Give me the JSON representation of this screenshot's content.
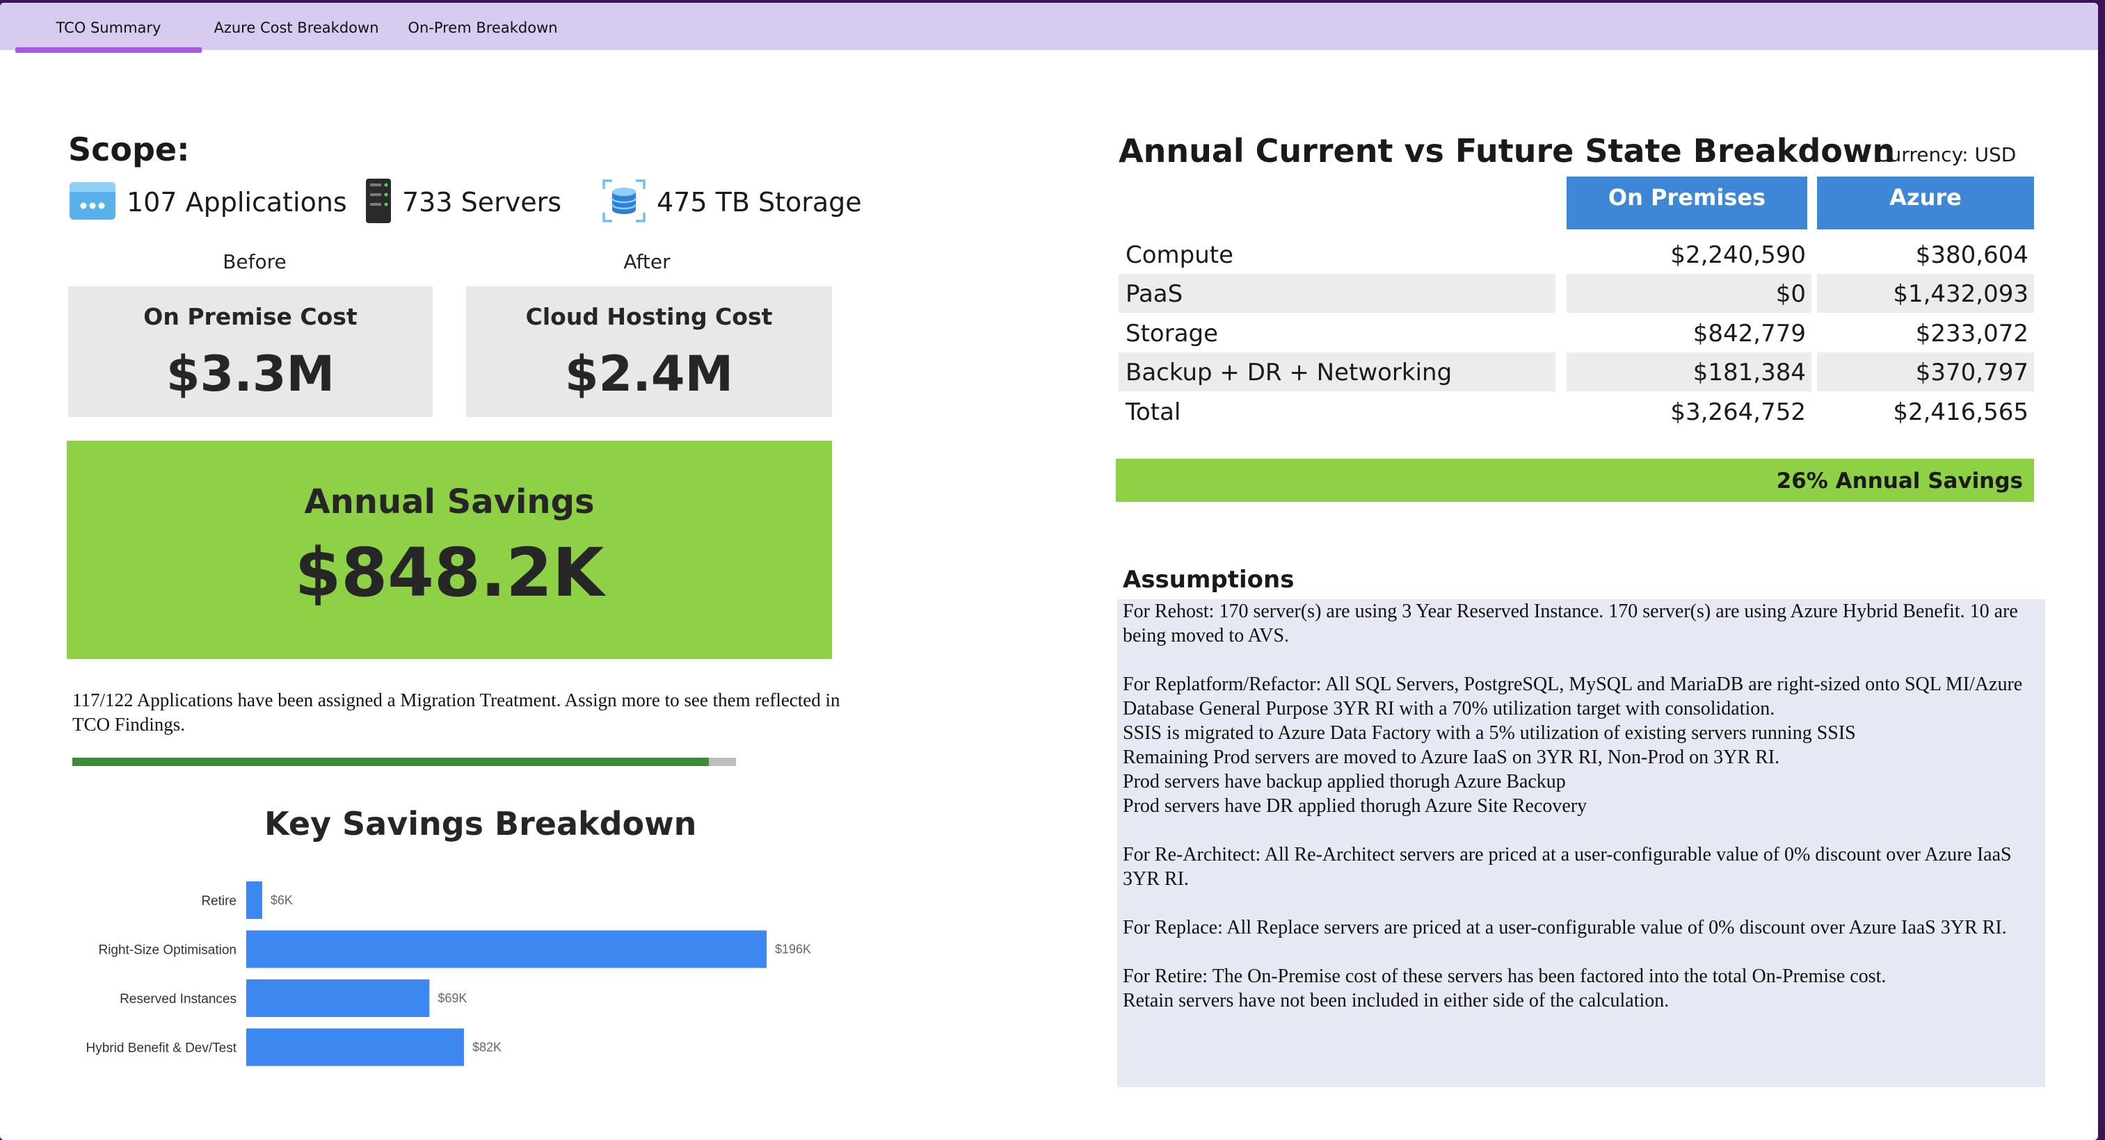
{
  "tabs": [
    {
      "label": "TCO Summary",
      "active": true
    },
    {
      "label": "Azure Cost Breakdown",
      "active": false
    },
    {
      "label": "On-Prem Breakdown",
      "active": false
    }
  ],
  "scope": {
    "title": "Scope:",
    "items": [
      {
        "icon": "application-window-icon",
        "label": "107 Applications"
      },
      {
        "icon": "server-icon",
        "label": "733 Servers"
      },
      {
        "icon": "storage-database-icon",
        "label": "475 TB Storage"
      }
    ]
  },
  "before_label": "Before",
  "after_label": "After",
  "on_premise_card": {
    "title": "On Premise Cost",
    "value": "$3.3M"
  },
  "cloud_card": {
    "title": "Cloud Hosting Cost",
    "value": "$2.4M"
  },
  "annual_savings": {
    "title": "Annual Savings",
    "value": "$848.2K"
  },
  "migration_progress": {
    "text": "117/122 Applications have been assigned a Migration Treatment. Assign more to see them reflected in TCO Findings.",
    "assigned": 117,
    "total": 122
  },
  "key_savings": {
    "title": "Key Savings Breakdown",
    "chart_data": {
      "type": "bar",
      "orientation": "horizontal",
      "categories": [
        "Retire",
        "Right-Size Optimisation",
        "Reserved Instances",
        "Hybrid Benefit & Dev/Test"
      ],
      "values": [
        6,
        196,
        69,
        82
      ],
      "value_labels": [
        "$6K",
        "$196K",
        "$69K",
        "$82K"
      ],
      "unit": "$K",
      "color": "#3d87f0",
      "title": "Key Savings Breakdown",
      "grid": false
    }
  },
  "breakdown": {
    "title": "Annual Current vs Future State Breakdown",
    "currency": "Currency: USD",
    "columns": [
      "On Premises",
      "Azure"
    ],
    "rows": [
      {
        "label": "Compute",
        "on_prem": "$2,240,590",
        "azure": "$380,604"
      },
      {
        "label": "PaaS",
        "on_prem": "$0",
        "azure": "$1,432,093"
      },
      {
        "label": "Storage",
        "on_prem": "$842,779",
        "azure": "$233,072"
      },
      {
        "label": "Backup + DR + Networking",
        "on_prem": "$181,384",
        "azure": "$370,797"
      },
      {
        "label": "Total",
        "on_prem": "$3,264,752",
        "azure": "$2,416,565"
      }
    ],
    "savings_label": "26% Annual Savings"
  },
  "assumptions": {
    "title": "Assumptions",
    "paragraphs": [
      [
        "For Rehost: 170 server(s) are using 3 Year Reserved Instance. 170 server(s) are using Azure Hybrid Benefit. 10 are being moved to AVS."
      ],
      [
        "For Replatform/Refactor: All SQL Servers, PostgreSQL, MySQL and MariaDB are right-sized onto SQL MI/Azure Database General Purpose 3YR RI with a 70% utilization target with consolidation.",
        "SSIS is migrated to Azure Data Factory with a 5% utilization of existing servers running SSIS",
        "Remaining Prod servers are moved to Azure IaaS on 3YR RI, Non-Prod on 3YR RI.",
        "Prod servers have backup applied thorugh Azure Backup",
        "Prod servers have DR applied thorugh Azure Site Recovery"
      ],
      [
        "For Re-Architect: All Re-Architect servers are priced at a user-configurable value of 0% discount over Azure IaaS 3YR RI."
      ],
      [
        "For Replace: All Replace servers are priced at a user-configurable value of 0% discount over Azure IaaS 3YR RI."
      ],
      [
        "For Retire: The On-Premise cost of these servers has been factored into the total On-Premise cost.",
        "Retain servers have not been included in either side of the calculation."
      ]
    ]
  },
  "colors": {
    "tab_bar": "#d8cbf0",
    "tab_active_underline": "#a85be0",
    "savings_green": "#8ed146",
    "header_blue": "#3d87d6",
    "bar_blue": "#3d87f0",
    "progress_green": "#3a8a3a"
  }
}
